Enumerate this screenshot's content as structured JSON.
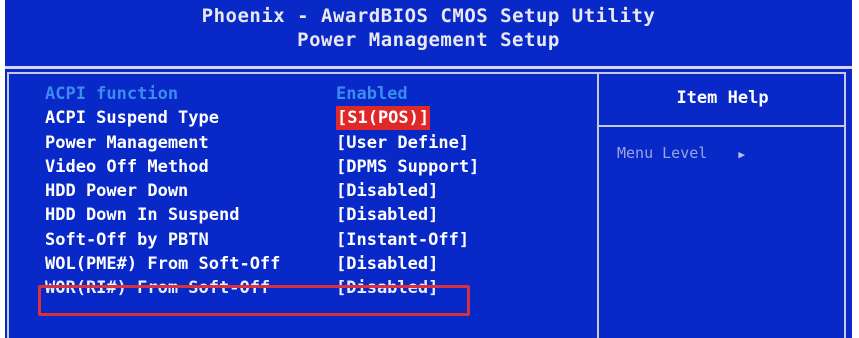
{
  "header": {
    "app_title": "Phoenix - AwardBIOS CMOS Setup Utility",
    "section_title": "Power Management Setup"
  },
  "settings": [
    {
      "label": "ACPI function",
      "value": "Enabled",
      "dimmed": true
    },
    {
      "label": "ACPI Suspend Type",
      "value": "[S1(POS)]",
      "selected": true
    },
    {
      "label": "Power Management",
      "value": "[User Define]"
    },
    {
      "label": "Video Off Method",
      "value": "[DPMS Support]"
    },
    {
      "label": "HDD Power Down",
      "value": "[Disabled]"
    },
    {
      "label": "HDD Down In Suspend",
      "value": "[Disabled]"
    },
    {
      "label": "Soft-Off by PBTN",
      "value": "[Instant-Off]"
    },
    {
      "label": "WOL(PME#) From Soft-Off",
      "value": "[Disabled]",
      "highlighted": true
    },
    {
      "label": "WOR(RI#) From Soft-Off",
      "value": "[Disabled]"
    }
  ],
  "item_help": {
    "title": "Item Help",
    "menu_level_label": "Menu Level",
    "arrow_icon": "triangle-right-icon"
  },
  "colors": {
    "background": "#0828c8",
    "text": "#ffffff",
    "dimmed_text": "#3c8cf0",
    "selection": "#e02828",
    "highlight_box": "#d8303c"
  }
}
